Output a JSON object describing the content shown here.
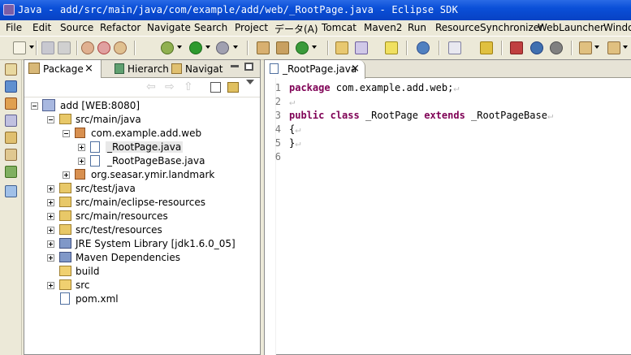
{
  "window": {
    "title": "Java - add/src/main/java/com/example/add/web/_RootPage.java - Eclipse SDK"
  },
  "menu": [
    "File",
    "Edit",
    "Source",
    "Refactor",
    "Navigate",
    "Search",
    "Project",
    "データ(A)",
    "Tomcat",
    "Maven2",
    "Run",
    "ResourceSynchronizer",
    "WebLauncher",
    "Window"
  ],
  "left_tabs": [
    {
      "label": "Package",
      "close": "×"
    },
    {
      "label": "Hierarch"
    },
    {
      "label": "Navigat"
    }
  ],
  "tree": [
    {
      "label": "add [WEB:8080]",
      "icon": "project-icon"
    },
    {
      "label": "src/main/java",
      "icon": "source-folder-icon"
    },
    {
      "label": "com.example.add.web",
      "icon": "package-icon"
    },
    {
      "label": "_RootPage.java",
      "icon": "java-file-icon"
    },
    {
      "label": "_RootPageBase.java",
      "icon": "java-file-icon"
    },
    {
      "label": "org.seasar.ymir.landmark",
      "icon": "package-icon"
    },
    {
      "label": "src/test/java",
      "icon": "source-folder-icon"
    },
    {
      "label": "src/main/eclipse-resources",
      "icon": "source-folder-icon"
    },
    {
      "label": "src/main/resources",
      "icon": "source-folder-icon"
    },
    {
      "label": "src/test/resources",
      "icon": "source-folder-icon"
    },
    {
      "label": "JRE System Library [jdk1.6.0_05]",
      "icon": "library-icon"
    },
    {
      "label": "Maven Dependencies",
      "icon": "maven-library-icon"
    },
    {
      "label": "build",
      "icon": "folder-icon"
    },
    {
      "label": "src",
      "icon": "folder-icon"
    },
    {
      "label": "pom.xml",
      "icon": "xml-file-icon"
    }
  ],
  "editor": {
    "tab": {
      "label": "_RootPage.java",
      "close": "×"
    },
    "lines": [
      {
        "num": "1",
        "kw1": "package",
        "text": " com.example.add.web;"
      },
      {
        "num": "2"
      },
      {
        "num": "3",
        "kw1": "public",
        "kw2": "class",
        "kw3": "extends",
        "name": "_RootPage",
        "base": "_RootPageBase"
      },
      {
        "num": "4",
        "text": "{"
      },
      {
        "num": "5",
        "text": "}"
      },
      {
        "num": "6"
      }
    ],
    "newline_glyph": "↵"
  },
  "colors": {
    "keyword": "#7f0055",
    "titlebar": "#0a4fd8"
  }
}
